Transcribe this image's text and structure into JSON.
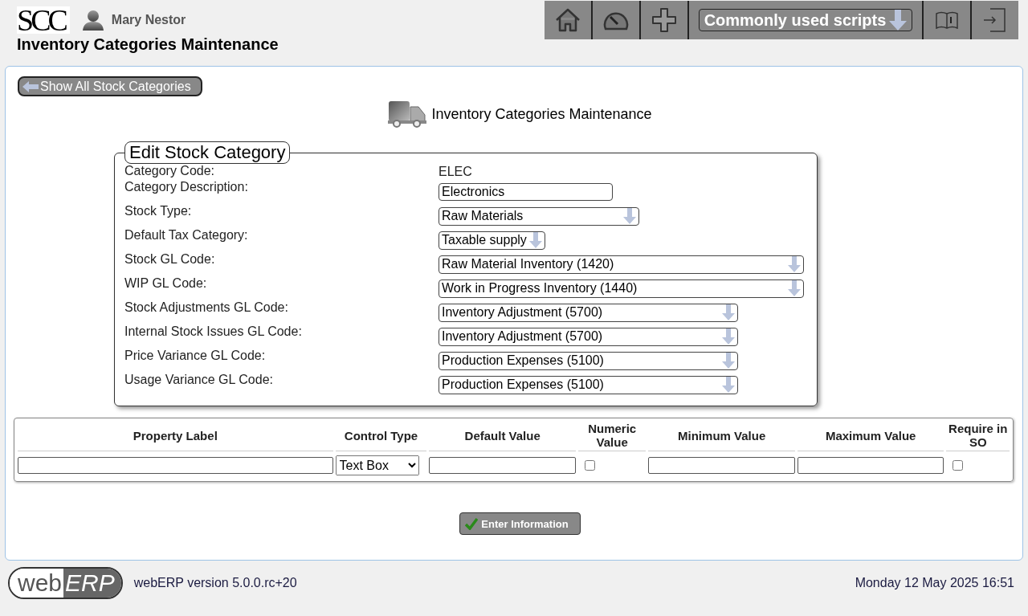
{
  "header": {
    "logo": "SCC",
    "user": "Mary Nestor",
    "title": "Inventory Categories Maintenance"
  },
  "toolbar": [
    {
      "kind": "home"
    },
    {
      "kind": "gauge"
    },
    {
      "kind": "plus"
    },
    {
      "kind": "dropdown",
      "label": "Commonly used scripts"
    },
    {
      "kind": "manual"
    },
    {
      "kind": "logout"
    }
  ],
  "back_button": "Show All Stock Categories",
  "page_heading": "Inventory Categories Maintenance",
  "form": {
    "legend": "Edit Stock Category",
    "fields": [
      {
        "label": "Category Code:",
        "kind": "text",
        "value": "ELEC"
      },
      {
        "label": "Category Description:",
        "kind": "input",
        "value": "Electronics"
      },
      {
        "label": "Stock Type:",
        "kind": "select",
        "value": "Raw Materials"
      },
      {
        "label": "Default Tax Category:",
        "kind": "select",
        "value": "Taxable supply"
      },
      {
        "label": "Stock GL Code:",
        "kind": "select",
        "value": "Raw Material Inventory (1420)"
      },
      {
        "label": "WIP GL Code:",
        "kind": "select",
        "value": "Work in Progress Inventory (1440)"
      },
      {
        "label": "Stock Adjustments GL Code:",
        "kind": "select",
        "value": "Inventory Adjustment (5700)"
      },
      {
        "label": "Internal Stock Issues GL Code:",
        "kind": "select",
        "value": "Inventory Adjustment (5700)"
      },
      {
        "label": "Price Variance GL Code:",
        "kind": "select",
        "value": "Production Expenses (5100)"
      },
      {
        "label": "Usage Variance GL Code:",
        "kind": "select",
        "value": "Production Expenses (5100)"
      }
    ]
  },
  "properties_table": {
    "columns": [
      "Property Label",
      "Control Type",
      "Default Value",
      "Numeric Value",
      "Minimum Value",
      "Maximum Value",
      "Require in SO"
    ],
    "row": [
      {
        "kind": "input"
      },
      {
        "kind": "select",
        "value": "Text Box"
      },
      {
        "kind": "input"
      },
      {
        "kind": "checkbox",
        "checked": false
      },
      {
        "kind": "input"
      },
      {
        "kind": "input"
      },
      {
        "kind": "checkbox",
        "checked": false
      }
    ]
  },
  "submit_button": "Enter Information",
  "footer": {
    "logo_left": "web",
    "logo_right": "ERP",
    "version": "webERP version 5.0.0.rc+20",
    "datetime": "Monday 12 May 2025 16:51"
  }
}
